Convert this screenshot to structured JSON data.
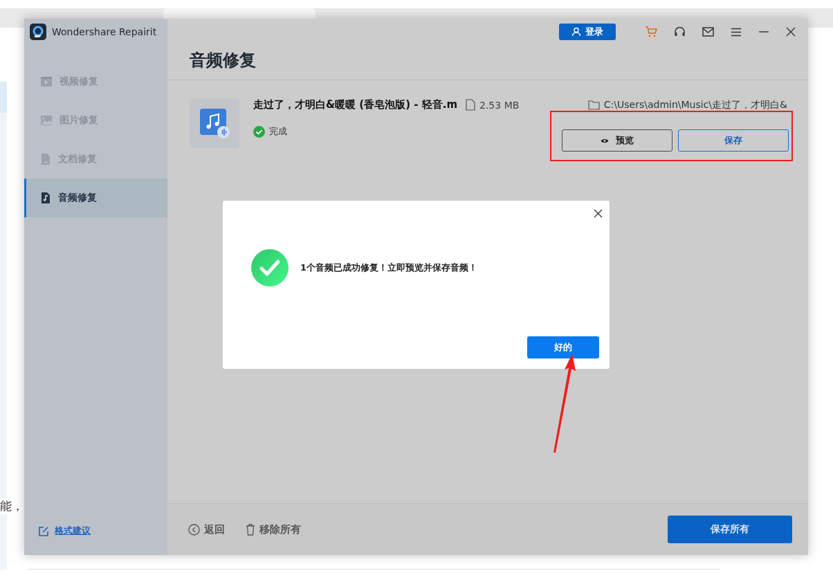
{
  "app": {
    "title": "Wondershare Repairit",
    "login": "登录"
  },
  "sidebar": {
    "items": [
      {
        "label": "视频修复",
        "kind": "video",
        "selected": false
      },
      {
        "label": "图片修复",
        "kind": "photo",
        "selected": false
      },
      {
        "label": "文档修复",
        "kind": "document",
        "selected": false
      },
      {
        "label": "音频修复",
        "kind": "audio",
        "selected": true
      }
    ],
    "feedback": "格式建议"
  },
  "page_title": "音频修复",
  "file": {
    "name": "走过了，才明白&暖暖 (香皂泡版) - 轻音.m",
    "size": "2.53  MB",
    "path": "C:\\Users\\admin\\Music\\走过了，才明白&",
    "status": "完成",
    "buttons": [
      {
        "label": "预览",
        "kind": "preview"
      },
      {
        "label": "保存",
        "kind": "save"
      }
    ]
  },
  "dialog": {
    "message": "1个音频已成功修复！立即预览并保存音频！",
    "ok": "好的"
  },
  "footer": {
    "back": "返回",
    "remove_all": "移除所有",
    "save_all": "保存所有"
  },
  "background": {
    "text": "能，"
  }
}
